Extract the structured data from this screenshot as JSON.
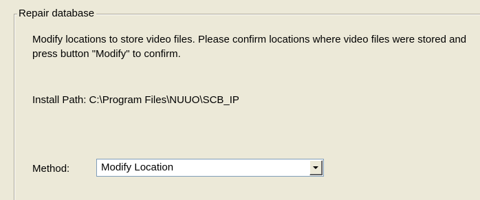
{
  "group": {
    "title": "Repair database"
  },
  "description": "Modify locations to store video files. Please confirm locations where video files were stored and press button \"Modify\" to confirm.",
  "install_path": "Install Path: C:\\Program Files\\NUUO\\SCB_IP",
  "method": {
    "label": "Method:",
    "selected_value": "Modify Location",
    "dropdown_icon": "chevron-down-icon"
  },
  "colors": {
    "background": "#ece9d8",
    "field_border": "#7f9db9",
    "groupbox_line": "#aca899"
  }
}
